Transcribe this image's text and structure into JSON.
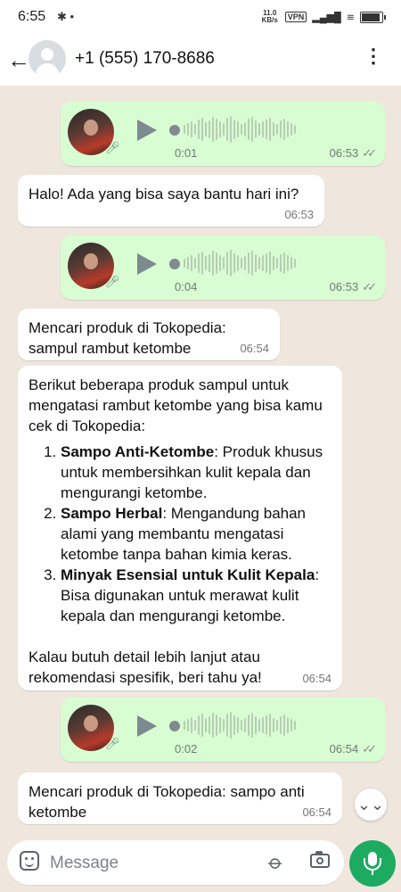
{
  "status_bar": {
    "time": "6:55",
    "left_icons": [
      "slack-icon",
      "dot-icon"
    ],
    "net_speed": "11.0 KB/s",
    "vpn": "VPN",
    "battery_level": 0.85
  },
  "header": {
    "contact_name": "+1 (555) 170-8686",
    "icons": [
      "back-arrow-icon",
      "avatar",
      "more-vert-icon"
    ]
  },
  "messages": [
    {
      "type": "voice",
      "direction": "out",
      "duration": "0:01",
      "time": "06:53",
      "ticks": "✓✓"
    },
    {
      "type": "text",
      "direction": "in",
      "text": "Halo! Ada yang bisa saya bantu hari ini?",
      "time": "06:53"
    },
    {
      "type": "voice",
      "direction": "out",
      "duration": "0:04",
      "time": "06:53",
      "ticks": "✓✓"
    },
    {
      "type": "text",
      "direction": "in",
      "text": "Mencari produk di Tokopedia: sampul rambut ketombe",
      "time": "06:54"
    },
    {
      "type": "list",
      "direction": "in",
      "intro": "Berikut beberapa produk sampul untuk mengatasi rambut ketombe yang bisa kamu cek di Tokopedia:",
      "items": [
        {
          "title": "Sampo Anti-Ketombe",
          "desc": ": Produk khusus untuk membersihkan kulit kepala dan mengurangi ketombe."
        },
        {
          "title": "Sampo Herbal",
          "desc": ": Mengandung bahan alami yang membantu mengatasi ketombe tanpa bahan kimia keras."
        },
        {
          "title": "Minyak Esensial untuk Kulit Kepala",
          "desc": ": Bisa digunakan untuk merawat kulit kepala dan mengurangi ketombe."
        }
      ],
      "outro": "Kalau butuh detail lebih lanjut atau rekomendasi spesifik, beri tahu ya!",
      "time": "06:54"
    },
    {
      "type": "voice",
      "direction": "out",
      "duration": "0:02",
      "time": "06:54",
      "ticks": "✓✓"
    },
    {
      "type": "text",
      "direction": "in",
      "text": "Mencari produk di Tokopedia: sampo anti ketombe",
      "time": "06:54"
    }
  ],
  "input": {
    "placeholder": "Message",
    "icons": [
      "emoji-sticker-icon",
      "attach-icon",
      "camera-icon",
      "mic-icon",
      "scroll-down-icon"
    ]
  },
  "colors": {
    "outgoing_bubble": "#d9fdd3",
    "incoming_bubble": "#ffffff",
    "chat_background": "#efe7de",
    "mic_button": "#1daa61"
  }
}
